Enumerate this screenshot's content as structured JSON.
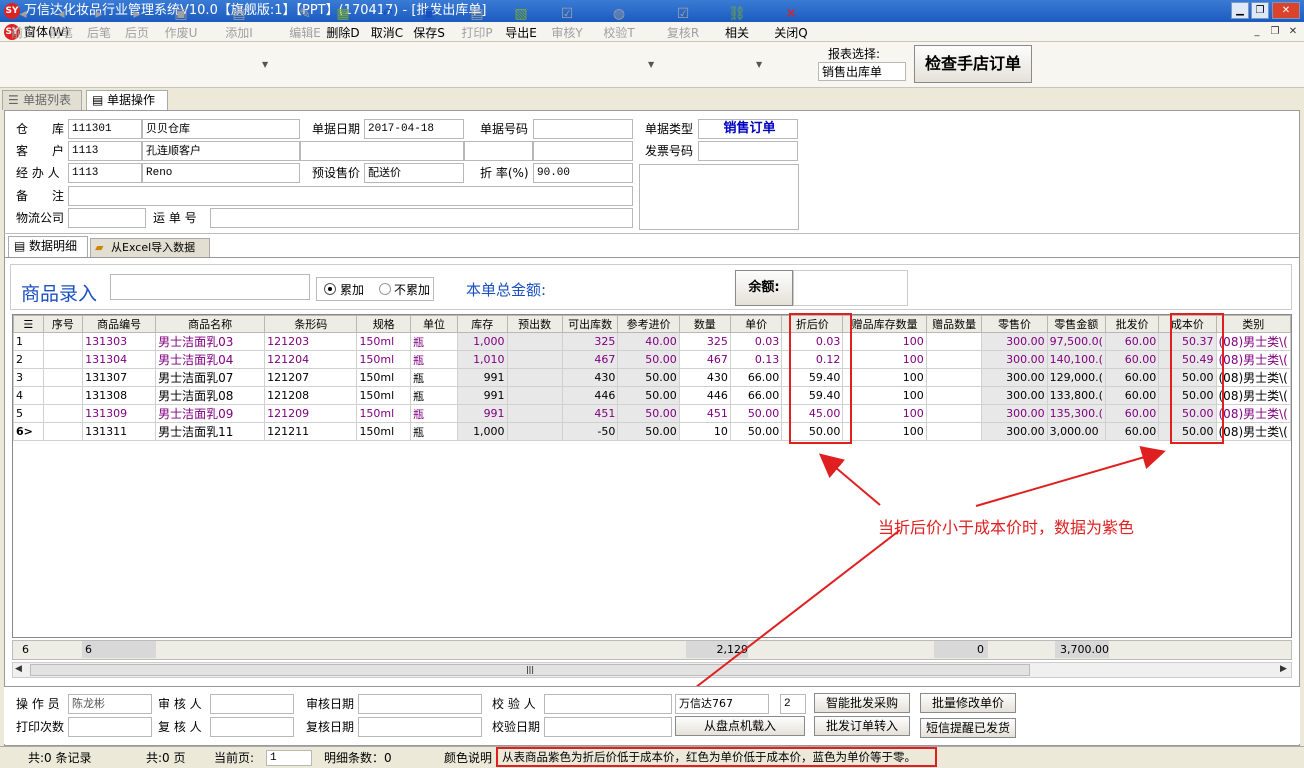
{
  "window": {
    "title": "万信达化妆品行业管理系统V10.0【旗舰版:1】【PPT】(170417) - [批发出库单]",
    "menu": "窗体(W)",
    "logo": "SY"
  },
  "toolbar": {
    "buttons": [
      {
        "label": "前页",
        "icon": "◂",
        "disabled": true
      },
      {
        "label": "前笔",
        "icon": "◂",
        "disabled": true
      },
      {
        "label": "后笔",
        "icon": "▸",
        "disabled": true
      },
      {
        "label": "后页",
        "icon": "▸",
        "disabled": true
      },
      {
        "label": "作废U",
        "icon": "▣",
        "disabled": true
      },
      {
        "label": "添加I",
        "icon": "▤",
        "disabled": true
      },
      {
        "label": "编辑E",
        "icon": "✎",
        "disabled": true
      },
      {
        "label": "删除D",
        "icon": "▦",
        "disabled": false
      },
      {
        "label": "取消C",
        "icon": "↶",
        "disabled": false
      },
      {
        "label": "保存S",
        "icon": "▣",
        "disabled": false
      },
      {
        "label": "打印P",
        "icon": "▤",
        "disabled": true
      },
      {
        "label": "导出E",
        "icon": "▧",
        "disabled": false
      },
      {
        "label": "审核Y",
        "icon": "☑",
        "disabled": true
      },
      {
        "label": "校验T",
        "icon": "◍",
        "disabled": true
      },
      {
        "label": "复核R",
        "icon": "☑",
        "disabled": true
      },
      {
        "label": "相关",
        "icon": "⛓",
        "disabled": false
      },
      {
        "label": "关闭Q",
        "icon": "✕",
        "disabled": false
      }
    ],
    "report_label": "报表选择:",
    "report_value": "销售出库单",
    "check_button": "检查手店订单"
  },
  "tabs": [
    "单据列表",
    "单据操作"
  ],
  "form": {
    "warehouse_label": "仓　　库",
    "warehouse_code": "111301",
    "warehouse_name": "贝贝仓库",
    "date_label": "单据日期",
    "date": "2017-04-18",
    "docno_label": "单据号码",
    "docno": "",
    "doctype_label": "单据类型",
    "doctype": "销售订单",
    "customer_label": "客　　户",
    "customer_code": "1113",
    "customer_name": "孔连顺客户",
    "invoice_label": "发票号码",
    "invoice": "",
    "handler_label": "经 办 人",
    "handler_code": "1113",
    "handler_name": "Reno",
    "preset_label": "预设售价",
    "preset": "配送价",
    "rate_label": "折 率(%)",
    "rate": "90.00",
    "remark_label": "备　　注",
    "remark": "",
    "logistics_label": "物流公司",
    "logistics": "",
    "waybill_label": "运 单 号",
    "waybill": ""
  },
  "subtabs": [
    "数据明细",
    "从Excel导入数据"
  ],
  "entry": {
    "label": "商品录入",
    "accumulate": "累加",
    "no_accumulate": "不累加",
    "total_label": "本单总金额:",
    "balance_button": "余额:"
  },
  "grid": {
    "columns": [
      "序号",
      "商品编号",
      "商品名称",
      "条形码",
      "规格",
      "单位",
      "库存",
      "预出数",
      "可出库数",
      "参考进价",
      "数量",
      "单价",
      "折后价",
      "赠品库存数量",
      "赠品数量",
      "零售价",
      "零售金额",
      "批发价",
      "成本价",
      "类别"
    ],
    "rows": [
      {
        "no": "1",
        "code": "131303",
        "name": "男士洁面乳03",
        "barcode": "121203",
        "spec": "150ml",
        "unit": "瓶",
        "stock": "1,000",
        "pre": "",
        "avail": "325",
        "ref": "40.00",
        "qty": "325",
        "price": "0.03",
        "disc": "0.03",
        "gstock": "100",
        "gqty": "",
        "retail": "300.00",
        "ramt": "97,500.0(",
        "whole": "60.00",
        "cost": "50.37",
        "cat": "(08)男士类\\(",
        "purple": true
      },
      {
        "no": "2",
        "code": "131304",
        "name": "男士洁面乳04",
        "barcode": "121204",
        "spec": "150ml",
        "unit": "瓶",
        "stock": "1,010",
        "pre": "",
        "avail": "467",
        "ref": "50.00",
        "qty": "467",
        "price": "0.13",
        "disc": "0.12",
        "gstock": "100",
        "gqty": "",
        "retail": "300.00",
        "ramt": "140,100.(",
        "whole": "60.00",
        "cost": "50.49",
        "cat": "(08)男士类\\(",
        "purple": true
      },
      {
        "no": "3",
        "code": "131307",
        "name": "男士洁面乳07",
        "barcode": "121207",
        "spec": "150ml",
        "unit": "瓶",
        "stock": "991",
        "pre": "",
        "avail": "430",
        "ref": "50.00",
        "qty": "430",
        "price": "66.00",
        "disc": "59.40",
        "gstock": "100",
        "gqty": "",
        "retail": "300.00",
        "ramt": "129,000.(",
        "whole": "60.00",
        "cost": "50.00",
        "cat": "(08)男士类\\(",
        "purple": false
      },
      {
        "no": "4",
        "code": "131308",
        "name": "男士洁面乳08",
        "barcode": "121208",
        "spec": "150ml",
        "unit": "瓶",
        "stock": "991",
        "pre": "",
        "avail": "446",
        "ref": "50.00",
        "qty": "446",
        "price": "66.00",
        "disc": "59.40",
        "gstock": "100",
        "gqty": "",
        "retail": "300.00",
        "ramt": "133,800.(",
        "whole": "60.00",
        "cost": "50.00",
        "cat": "(08)男士类\\(",
        "purple": false
      },
      {
        "no": "5",
        "code": "131309",
        "name": "男士洁面乳09",
        "barcode": "121209",
        "spec": "150ml",
        "unit": "瓶",
        "stock": "991",
        "pre": "",
        "avail": "451",
        "ref": "50.00",
        "qty": "451",
        "price": "50.00",
        "disc": "45.00",
        "gstock": "100",
        "gqty": "",
        "retail": "300.00",
        "ramt": "135,300.(",
        "whole": "60.00",
        "cost": "50.00",
        "cat": "(08)男士类\\(",
        "purple": true
      },
      {
        "no": "6>",
        "code": "131311",
        "name": "男士洁面乳11",
        "barcode": "121211",
        "spec": "150ml",
        "unit": "瓶",
        "stock": "1,000",
        "pre": "",
        "avail": "-50",
        "ref": "50.00",
        "qty": "10",
        "price": "50.00",
        "disc": "50.00",
        "gstock": "100",
        "gqty": "",
        "retail": "300.00",
        "ramt": "3,000.00",
        "whole": "60.00",
        "cost": "50.00",
        "cat": "(08)男士类\\(",
        "purple": false
      }
    ],
    "footer": {
      "count": "6",
      "count2": "6",
      "qty": "2,129",
      "gqty": "0",
      "ramt": "3,700.00"
    }
  },
  "annotation": "当折后价小于成本价时，数据为紫色",
  "bottom": {
    "operator_label": "操 作 员",
    "operator": "陈龙彬",
    "auditor_label": "审 核 人",
    "auditor": "",
    "audit_date_label": "审核日期",
    "audit_date": "",
    "checker_label": "校 验 人",
    "checker": "",
    "print_label": "打印次数",
    "print": "",
    "reviewer_label": "复 核 人",
    "reviewer": "",
    "review_date_label": "复核日期",
    "review_date": "",
    "check_date_label": "校验日期",
    "check_date": "",
    "store": "万信达767",
    "store_num": "2",
    "btn_smart": "智能批发采购",
    "btn_batch": "批量修改单价",
    "btn_scan": "从盘点机载入",
    "btn_order": "批发订单转入",
    "btn_sms": "短信提醒已发货"
  },
  "status": {
    "records": "共:0 条记录",
    "pages": "共:0 页",
    "current_label": "当前页:",
    "current": "1",
    "detail": "明细条数：0",
    "color_label": "颜色说明",
    "color_note": "从表商品紫色为折后价低于成本价，红色为单价低于成本价，蓝色为单价等于零。"
  },
  "colors": {
    "purple": "#800080",
    "red": "#e02020",
    "blue": "#0000c0"
  }
}
